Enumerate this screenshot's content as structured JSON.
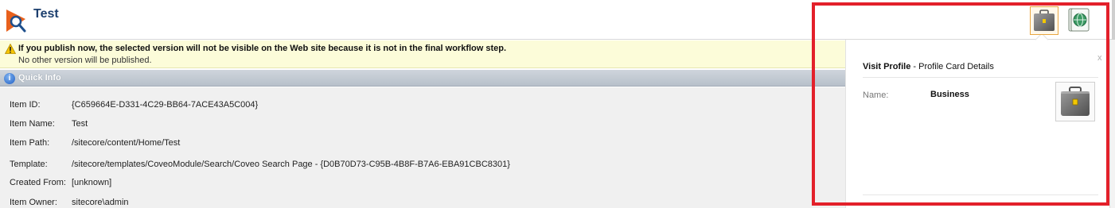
{
  "header": {
    "item_title": "Test"
  },
  "warning": {
    "message": "If you publish now, the selected version will not be visible on the Web site because it is not in the final workflow step.",
    "sub_message": "No other version will be published."
  },
  "quick_info": {
    "title": "Quick Info",
    "rows": [
      {
        "label": "Item ID:",
        "value": "{C659664E-D331-4C29-BB64-7ACE43A5C004}"
      },
      {
        "label": "Item Name:",
        "value": "Test"
      },
      {
        "label": "Item Path:",
        "value": "/sitecore/content/Home/Test"
      },
      {
        "label": "Template:",
        "value": "/sitecore/templates/CoveoModule/Search/Coveo Search Page - {D0B70D73-C95B-4B8F-B7A6-EBA91CBC8301}"
      },
      {
        "label": "Created From:",
        "value": "[unknown]"
      },
      {
        "label": "Item Owner:",
        "value": "sitecore\\admin"
      }
    ]
  },
  "profile_panel": {
    "title_bold": "Visit Profile",
    "title_rest": " - Profile Card Details",
    "close": "x",
    "name_label": "Name:",
    "name_value": "Business"
  },
  "toolbar": {
    "buttons": [
      {
        "icon": "briefcase-icon",
        "selected": true
      },
      {
        "icon": "globe-book-icon",
        "selected": false
      }
    ]
  },
  "colors": {
    "highlight": "#e3202a",
    "title": "#1c3f6e",
    "warning_bg": "#fcfcd9",
    "selected_border": "#e8a640"
  }
}
